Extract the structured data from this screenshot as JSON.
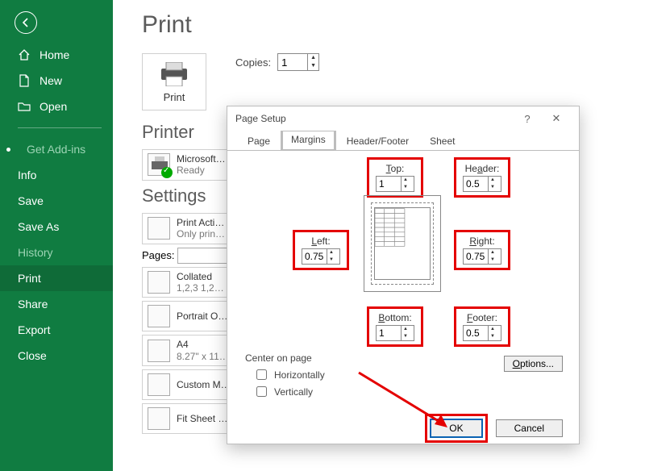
{
  "page_title": "Print",
  "sidebar": {
    "items": [
      {
        "label": "Home",
        "icon": "home-icon"
      },
      {
        "label": "New",
        "icon": "new-icon"
      },
      {
        "label": "Open",
        "icon": "open-icon"
      }
    ],
    "second": [
      {
        "label": "Get Add-ins",
        "dim": true,
        "bullet": true
      },
      {
        "label": "Info"
      },
      {
        "label": "Save"
      },
      {
        "label": "Save As"
      },
      {
        "label": "History",
        "dim": true
      },
      {
        "label": "Print",
        "active": true
      },
      {
        "label": "Share"
      },
      {
        "label": "Export"
      },
      {
        "label": "Close"
      }
    ]
  },
  "print": {
    "button_label": "Print",
    "copies_label": "Copies:",
    "copies_value": "1"
  },
  "printer": {
    "heading": "Printer",
    "name": "Microsoft…",
    "status": "Ready"
  },
  "settings": {
    "heading": "Settings",
    "pages_label": "Pages:",
    "rows": [
      {
        "l1": "Print Acti…",
        "l2": "Only prin…"
      },
      {
        "l1": "Collated",
        "l2": "1,2,3   1,2…"
      },
      {
        "l1": "Portrait O…",
        "l2": ""
      },
      {
        "l1": "A4",
        "l2": "8.27\" x 11…"
      },
      {
        "l1": "Custom M…",
        "l2": ""
      },
      {
        "l1": "Fit Sheet …",
        "l2": ""
      }
    ]
  },
  "dialog": {
    "title": "Page Setup",
    "tabs": [
      "Page",
      "Margins",
      "Header/Footer",
      "Sheet"
    ],
    "selected_tab": "Margins",
    "margins": {
      "top": {
        "label": "Top:",
        "value": "1"
      },
      "header": {
        "label": "Header:",
        "value": "0.5"
      },
      "left": {
        "label": "Left:",
        "value": "0.75"
      },
      "right": {
        "label": "Right:",
        "value": "0.75"
      },
      "bottom": {
        "label": "Bottom:",
        "value": "1"
      },
      "footer": {
        "label": "Footer:",
        "value": "0.5"
      }
    },
    "center_label": "Center on page",
    "center_h": "Horizontally",
    "center_v": "Vertically",
    "options_btn": "Options...",
    "ok": "OK",
    "cancel": "Cancel"
  }
}
